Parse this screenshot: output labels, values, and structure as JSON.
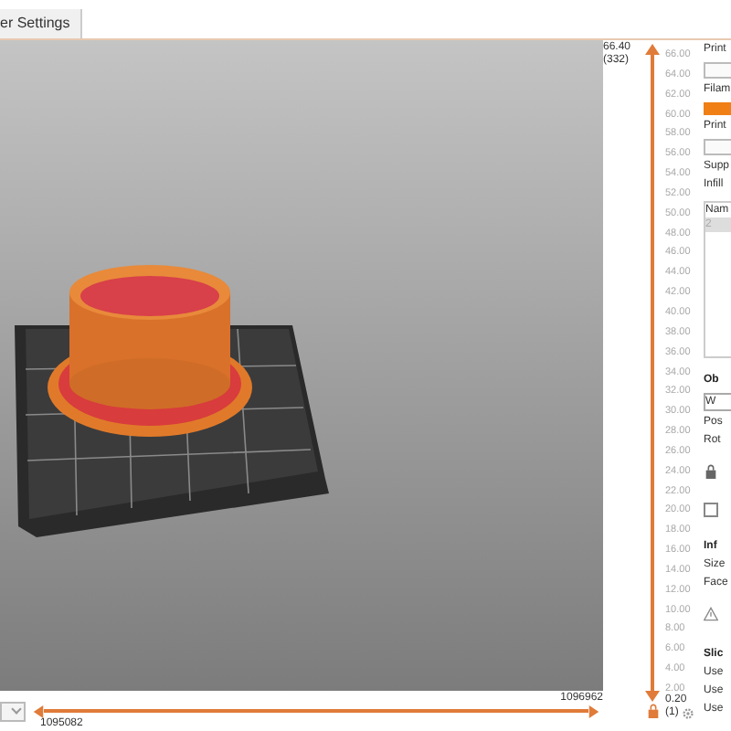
{
  "tab": {
    "label": "er Settings",
    "selected": true
  },
  "vertical_slider": {
    "level": 1,
    "top_value": "66.40",
    "top_layer": "(332)",
    "bottom_value": "0.20",
    "bottom_layer": "(1)",
    "ticks": [
      "66.00",
      "64.00",
      "62.00",
      "60.00",
      "58.00",
      "56.00",
      "54.00",
      "52.00",
      "50.00",
      "48.00",
      "46.00",
      "44.00",
      "42.00",
      "40.00",
      "38.00",
      "36.00",
      "34.00",
      "32.00",
      "30.00",
      "28.00",
      "26.00",
      "24.00",
      "22.00",
      "20.00",
      "18.00",
      "16.00",
      "14.00",
      "12.00",
      "10.00",
      "8.00",
      "6.00",
      "4.00",
      "2.00"
    ]
  },
  "horizontal_slider": {
    "left_value": "1095082",
    "right_value": "1096962",
    "level": 1
  },
  "panel": [
    {
      "kind": "label",
      "text": "Print"
    },
    {
      "kind": "combo"
    },
    {
      "kind": "label",
      "text": "Filam"
    },
    {
      "kind": "swatch",
      "color": "#f07f16"
    },
    {
      "kind": "label",
      "text": "Print"
    },
    {
      "kind": "combo"
    },
    {
      "kind": "label",
      "text": "Supp"
    },
    {
      "kind": "label",
      "text": "Infill"
    },
    {
      "kind": "table",
      "header": "Nam",
      "rows": [
        {
          "text": "2",
          "selected": true
        }
      ]
    },
    {
      "kind": "heading",
      "text": "Ob"
    },
    {
      "kind": "field",
      "text": "W"
    },
    {
      "kind": "label",
      "text": "Pos"
    },
    {
      "kind": "label",
      "text": "Rot"
    },
    {
      "kind": "lock"
    },
    {
      "kind": "checkbox",
      "checked": false
    },
    {
      "kind": "heading",
      "text": "Inf"
    },
    {
      "kind": "label",
      "text": "Size"
    },
    {
      "kind": "label",
      "text": "Face"
    },
    {
      "kind": "warning"
    },
    {
      "kind": "heading",
      "text": "Slic"
    },
    {
      "kind": "label",
      "text": "Use"
    },
    {
      "kind": "label",
      "text": "Use"
    },
    {
      "kind": "label",
      "text": "Use"
    }
  ]
}
